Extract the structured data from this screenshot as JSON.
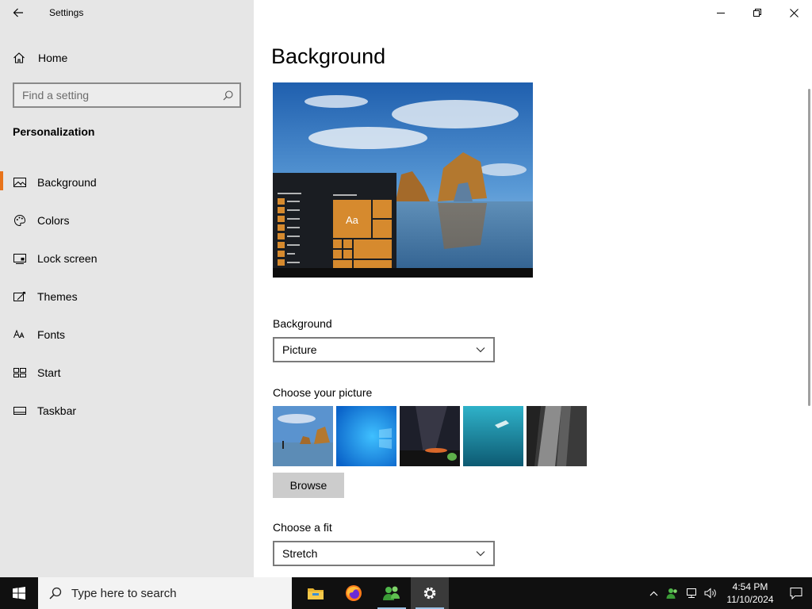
{
  "window": {
    "title": "Settings",
    "controls": [
      "minimize",
      "restore",
      "close"
    ]
  },
  "sidebar": {
    "home_label": "Home",
    "search_placeholder": "Find a setting",
    "section_title": "Personalization",
    "items": [
      {
        "label": "Background",
        "icon": "picture-icon",
        "active": true
      },
      {
        "label": "Colors",
        "icon": "palette-icon",
        "active": false
      },
      {
        "label": "Lock screen",
        "icon": "lock-screen-icon",
        "active": false
      },
      {
        "label": "Themes",
        "icon": "themes-icon",
        "active": false
      },
      {
        "label": "Fonts",
        "icon": "fonts-icon",
        "active": false
      },
      {
        "label": "Start",
        "icon": "start-icon",
        "active": false
      },
      {
        "label": "Taskbar",
        "icon": "taskbar-icon",
        "active": false
      }
    ]
  },
  "main": {
    "page_title": "Background",
    "preview_tile_text": "Aa",
    "background_label": "Background",
    "background_value": "Picture",
    "choose_picture_label": "Choose your picture",
    "thumbnails": [
      "beach-rock-thumb",
      "windows-blue-thumb",
      "night-sky-thumb",
      "underwater-swimmer-thumb",
      "rock-cliff-thumb"
    ],
    "browse_label": "Browse",
    "fit_label": "Choose a fit",
    "fit_value": "Stretch"
  },
  "taskbar": {
    "search_placeholder": "Type here to search",
    "apps": [
      "file-explorer-icon",
      "firefox-icon",
      "people-icon",
      "settings-gear-icon"
    ],
    "clock_time": "4:54 PM",
    "clock_date": "11/10/2024"
  },
  "colors": {
    "accent": "#e8731a",
    "tile": "#d68a2e",
    "sidebar_bg": "#e6e6e6",
    "taskbar_bg": "#101010"
  }
}
